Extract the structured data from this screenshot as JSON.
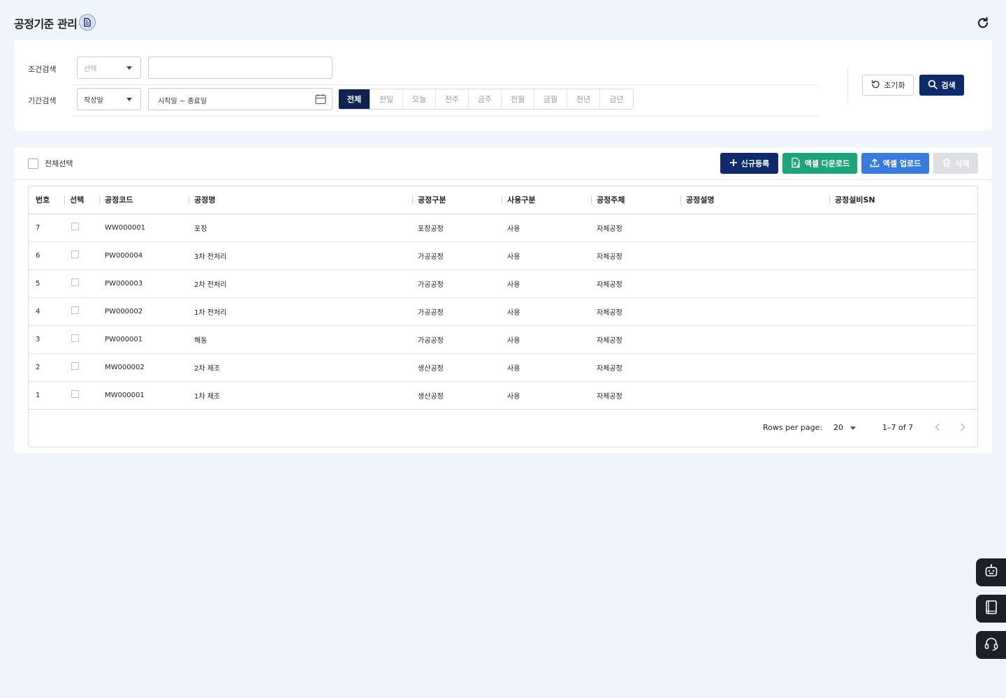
{
  "page": {
    "title": "공정기준 관리"
  },
  "search": {
    "condition_label": "조건검색",
    "condition_select_placeholder": "선택",
    "condition_input_value": "",
    "period_label": "기간검색",
    "period_select_value": "작성일",
    "date_range_placeholder": "시작일 ~ 종료일",
    "period_buttons": [
      "전체",
      "전일",
      "오늘",
      "전주",
      "금주",
      "전월",
      "금월",
      "전년",
      "금년"
    ],
    "active_period": "전체",
    "reset_label": "초기화",
    "search_label": "검색"
  },
  "toolbar": {
    "select_all_label": "전체선택",
    "new_label": "신규등록",
    "excel_download_label": "엑셀 다운로드",
    "excel_upload_label": "엑셀 업로드",
    "delete_label": "삭제"
  },
  "table": {
    "columns": [
      "번호",
      "선택",
      "공정코드",
      "공정명",
      "공정구분",
      "사용구분",
      "공정주체",
      "공정설명",
      "공정설비SN"
    ],
    "rows": [
      {
        "no": "7",
        "code": "WW000001",
        "name": "포장",
        "type": "포장공정",
        "use": "사용",
        "owner": "자체공정",
        "desc": "",
        "sn": ""
      },
      {
        "no": "6",
        "code": "PW000004",
        "name": "3차 전처리",
        "type": "가공공정",
        "use": "사용",
        "owner": "자체공정",
        "desc": "",
        "sn": ""
      },
      {
        "no": "5",
        "code": "PW000003",
        "name": "2차 전처리",
        "type": "가공공정",
        "use": "사용",
        "owner": "자체공정",
        "desc": "",
        "sn": ""
      },
      {
        "no": "4",
        "code": "PW000002",
        "name": "1차 전처리",
        "type": "가공공정",
        "use": "사용",
        "owner": "자체공정",
        "desc": "",
        "sn": ""
      },
      {
        "no": "3",
        "code": "PW000001",
        "name": "해동",
        "type": "가공공정",
        "use": "사용",
        "owner": "자체공정",
        "desc": "",
        "sn": ""
      },
      {
        "no": "2",
        "code": "MW000002",
        "name": "2차 제조",
        "type": "생산공정",
        "use": "사용",
        "owner": "자체공정",
        "desc": "",
        "sn": ""
      },
      {
        "no": "1",
        "code": "MW000001",
        "name": "1차 제조",
        "type": "생산공정",
        "use": "사용",
        "owner": "자체공정",
        "desc": "",
        "sn": ""
      }
    ]
  },
  "pagination": {
    "rows_per_page_label": "Rows per page:",
    "rows_per_page": "20",
    "range": "1–7 of 7"
  },
  "icons": {
    "title": "document-icon",
    "refresh": "refresh-icon",
    "calendar": "calendar-icon",
    "reset": "reset-icon",
    "search": "search-icon",
    "new": "plus-icon",
    "excel_download": "excel-download-icon",
    "excel_upload": "upload-icon",
    "delete": "trash-icon",
    "side": [
      "chatbot-icon",
      "manual-book-icon",
      "headset-icon"
    ]
  },
  "colors": {
    "primary": "#0e2a6b",
    "excel_green": "#1fa37a",
    "upload_blue": "#3a7bde",
    "disabled": "#dddfe3",
    "background": "#f0f4fb"
  }
}
